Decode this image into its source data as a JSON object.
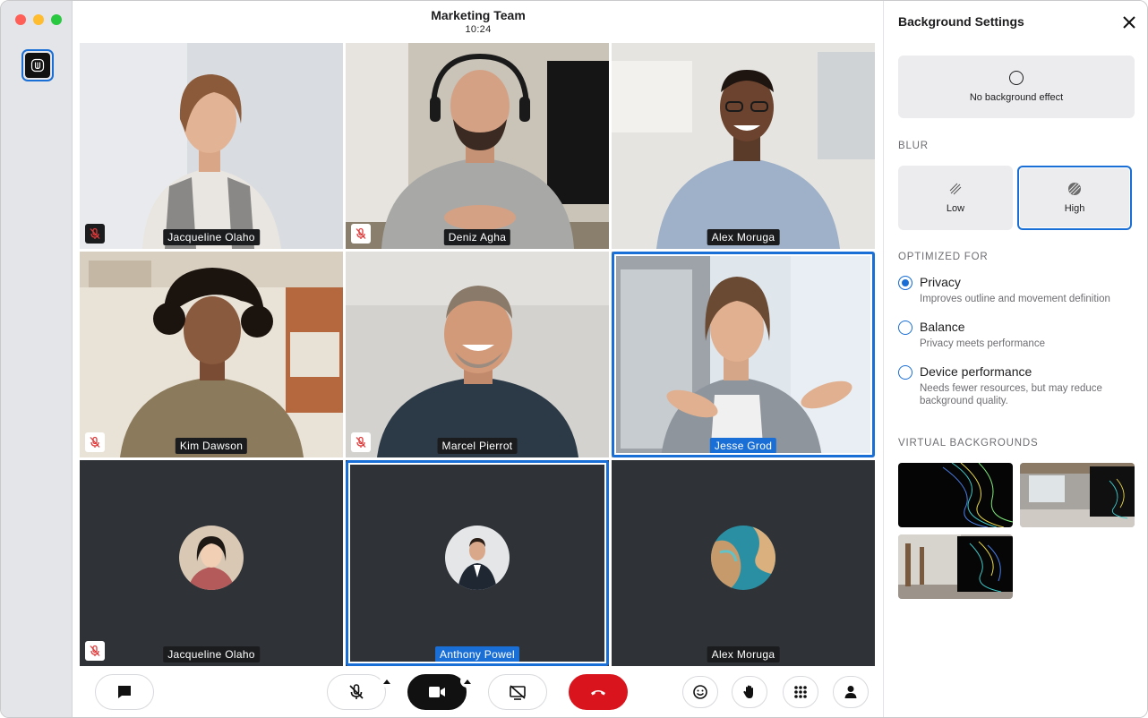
{
  "window": {
    "traffic_lights": [
      "close",
      "minimize",
      "zoom"
    ]
  },
  "meeting": {
    "title": "Marketing Team",
    "time": "10:24"
  },
  "participants": [
    {
      "name": "Jacqueline Olaho",
      "muted": true,
      "video": true,
      "speaking": false
    },
    {
      "name": "Deniz Agha",
      "muted": true,
      "video": true,
      "speaking": false
    },
    {
      "name": "Alex Moruga",
      "muted": false,
      "video": true,
      "speaking": false
    },
    {
      "name": "Kim Dawson",
      "muted": true,
      "video": true,
      "speaking": false
    },
    {
      "name": "Marcel Pierrot",
      "muted": true,
      "video": true,
      "speaking": false
    },
    {
      "name": "Jesse Grod",
      "muted": false,
      "video": true,
      "speaking": true
    },
    {
      "name": "Jacqueline Olaho",
      "muted": true,
      "video": false,
      "speaking": false
    },
    {
      "name": "Anthony Powel",
      "muted": false,
      "video": false,
      "speaking": true
    },
    {
      "name": "Alex Moruga",
      "muted": false,
      "video": false,
      "speaking": false
    }
  ],
  "toolbar": {
    "chat": "chat-icon",
    "mic": "mic-off-icon",
    "camera": "video-camera-icon",
    "screen_share": "screen-share-off-icon",
    "end_call": "hang-up-icon",
    "reactions": "emoji-icon",
    "raise_hand": "hand-icon",
    "apps": "grid-icon",
    "participants": "person-icon"
  },
  "panel": {
    "title": "Background Settings",
    "no_effect_label": "No background effect",
    "blur_section": "BLUR",
    "blur_options": [
      {
        "label": "Low",
        "selected": false
      },
      {
        "label": "High",
        "selected": true
      }
    ],
    "optimized_section": "OPTIMIZED FOR",
    "optimized_options": [
      {
        "title": "Privacy",
        "desc": "Improves outline and movement definition",
        "checked": true
      },
      {
        "title": "Balance",
        "desc": "Privacy meets performance",
        "checked": false
      },
      {
        "title": "Device performance",
        "desc": "Needs fewer resources, but may reduce background quality.",
        "checked": false
      }
    ],
    "virtual_section": "VIRTUAL BACKGROUNDS",
    "virtual_backgrounds": [
      "wave-dark",
      "office-wall",
      "hallway-wave"
    ]
  },
  "colors": {
    "accent": "#1a6fd6",
    "end_call": "#d9141c",
    "tile_dark": "#2f3237",
    "mute_red": "#e03a3a"
  }
}
